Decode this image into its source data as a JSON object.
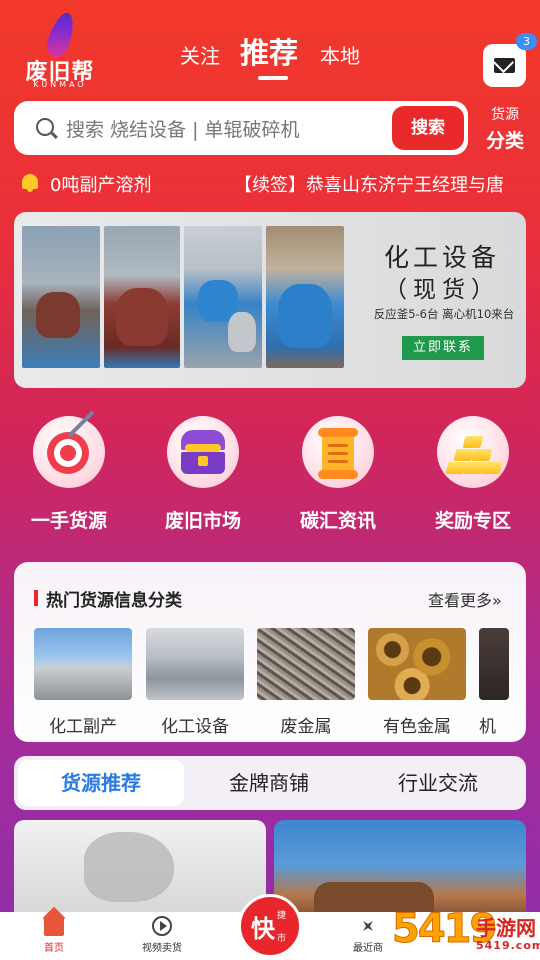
{
  "header": {
    "logo_text": "废旧帮",
    "logo_sub": "KUNMAO",
    "tabs": [
      "关注",
      "推荐",
      "本地"
    ],
    "active_tab": "推荐",
    "message_badge": "3"
  },
  "search": {
    "placeholder": "搜索 烧结设备 | 单辊破碎机",
    "button_label": "搜索",
    "category_line1": "货源",
    "category_line2": "分类"
  },
  "ticker": {
    "items": [
      "0吨副产溶剂",
      "【续签】恭喜山东济宁王经理与唐"
    ]
  },
  "banner": {
    "title": "化工设备",
    "subtitle": "（现货）",
    "description": "反应釜5-6台  离心机10来台",
    "button_label": "立即联系"
  },
  "quick_entries": [
    {
      "label": "一手货源",
      "icon": "target-icon"
    },
    {
      "label": "废旧市场",
      "icon": "treasure-chest-icon"
    },
    {
      "label": "碳汇资讯",
      "icon": "scroll-icon"
    },
    {
      "label": "奖励专区",
      "icon": "gold-bars-icon"
    }
  ],
  "hot_categories": {
    "title": "热门货源信息分类",
    "more_label": "查看更多»",
    "items": [
      {
        "label": "化工副产"
      },
      {
        "label": "化工设备"
      },
      {
        "label": "废金属"
      },
      {
        "label": "有色金属"
      },
      {
        "label": "机"
      }
    ]
  },
  "segments": {
    "tabs": [
      "货源推荐",
      "金牌商铺",
      "行业交流"
    ],
    "active": "货源推荐"
  },
  "bottom_nav": {
    "items": [
      "首页",
      "视频卖货",
      "",
      "最近商"
    ],
    "center": {
      "big": "快",
      "small_top": "捷",
      "small_bottom": "市"
    }
  },
  "watermark": {
    "number": "5419",
    "text": "手游网",
    "site": "5419.com"
  },
  "colors": {
    "primary_red": "#e8262b",
    "accent_blue": "#2a7be4",
    "banner_green": "#1f9a4d"
  }
}
